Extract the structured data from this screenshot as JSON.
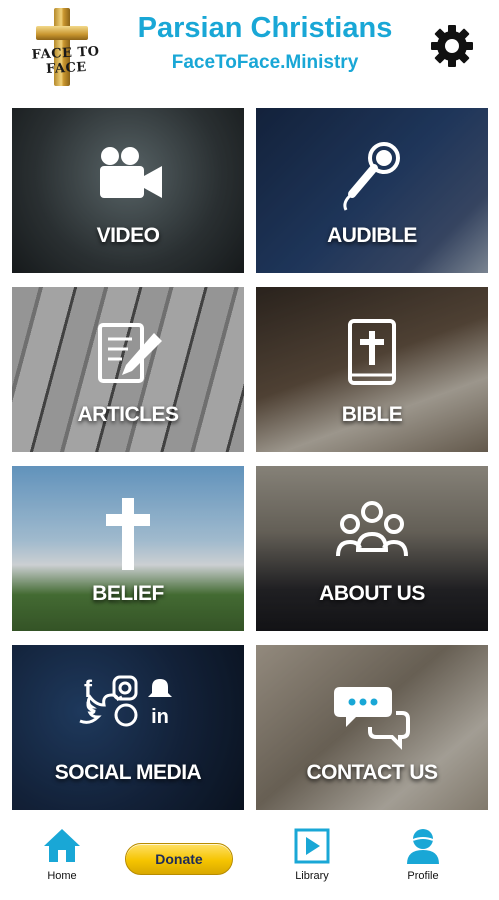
{
  "header": {
    "logo_text": "FACE TO FACE",
    "title": "Parsian Christians",
    "subtitle": "FaceToFace.Ministry"
  },
  "tiles": [
    {
      "label": "VIDEO",
      "icon": "video-camera-icon"
    },
    {
      "label": "AUDIBLE",
      "icon": "microphone-icon"
    },
    {
      "label": "ARTICLES",
      "icon": "document-pen-icon"
    },
    {
      "label": "BIBLE",
      "icon": "bible-icon"
    },
    {
      "label": "BELIEF",
      "icon": "cross-icon"
    },
    {
      "label": "ABOUT US",
      "icon": "group-icon"
    },
    {
      "label": "SOCIAL MEDIA",
      "icon": "social-icons"
    },
    {
      "label": "CONTACT US",
      "icon": "chat-bubbles-icon"
    }
  ],
  "bottom_nav": {
    "home_label": "Home",
    "donate_label": "Donate",
    "library_label": "Library",
    "profile_label": "Profile"
  },
  "colors": {
    "accent": "#19a7d6",
    "donate": "#f5c400"
  }
}
